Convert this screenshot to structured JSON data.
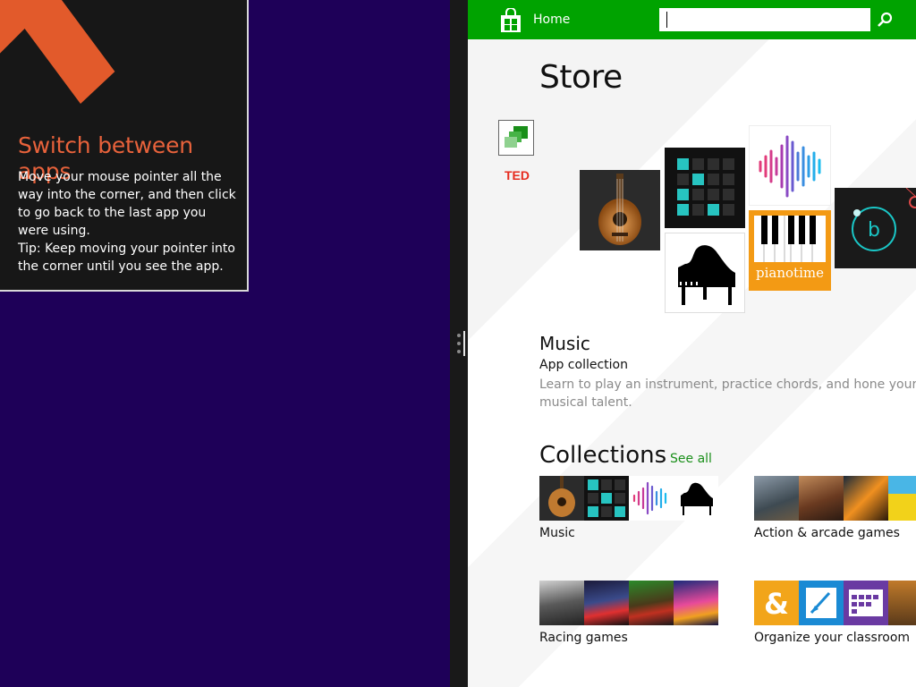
{
  "tutorial": {
    "title": "Switch between apps",
    "body": "Move your mouse pointer all the way into the corner, and then click to go back to the last app you were using.",
    "tip": "Tip: Keep moving your pointer into the corner until you see the app."
  },
  "store": {
    "nav": {
      "home_label": "Home"
    },
    "search": {
      "value": "",
      "placeholder": ""
    },
    "page_title": "Store",
    "promo_icon_2_label": "TED",
    "featured": {
      "title": "Music",
      "subtitle": "App collection",
      "description": "Learn to play an instrument, practice chords, and hone your musical talent.",
      "tiles": [
        {
          "name": "guitar"
        },
        {
          "name": "drum-pads"
        },
        {
          "name": "waveform"
        },
        {
          "name": "grand-piano"
        },
        {
          "name": "pianotime",
          "label": "pianotime"
        },
        {
          "name": "b-circle",
          "label": "b"
        }
      ]
    },
    "collections": {
      "title": "Collections",
      "see_all": "See all",
      "items": [
        {
          "label": "Music"
        },
        {
          "label": "Action & arcade games"
        },
        {
          "label": "Racing games"
        },
        {
          "label": "Organize your classroom"
        }
      ]
    }
  },
  "colors": {
    "desktop_bg": "#1e0058",
    "tip_accent": "#e8623b",
    "store_green": "#00a300",
    "link_green": "#1a8f1a"
  },
  "icons": [
    "arrow-up-left-icon",
    "store-bag-icon",
    "search-icon",
    "collection-icon",
    "ted-logo"
  ]
}
